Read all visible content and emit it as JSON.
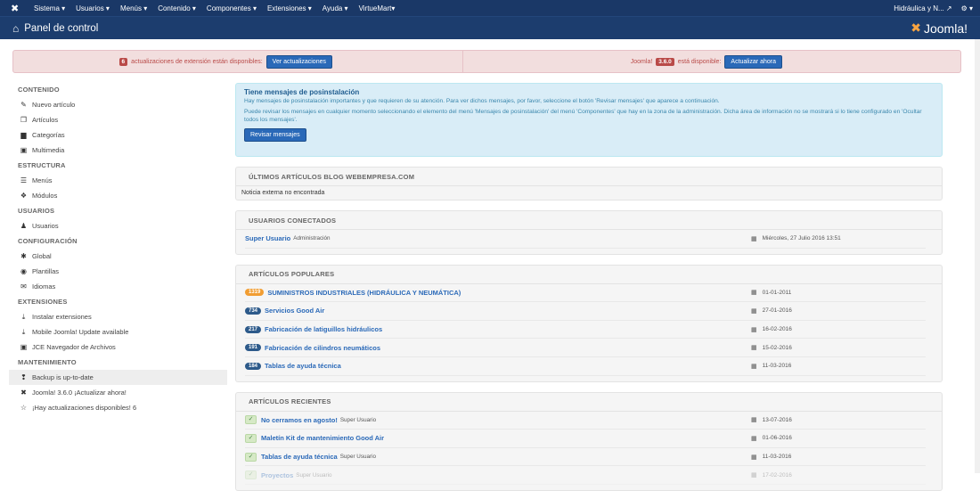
{
  "topbar": {
    "menu": [
      "Sistema ▾",
      "Usuarios ▾",
      "Menús ▾",
      "Contenido ▾",
      "Componentes ▾",
      "Extensiones ▾",
      "Ayuda ▾",
      "VirtueMart▾"
    ],
    "site_label": "Hidráulica y N... ↗",
    "settings_label": "⚙ ▾"
  },
  "header": {
    "title": "Panel de control",
    "brand": "Joomla!"
  },
  "alert": {
    "left_count": "6",
    "left_text": "actualizaciones de extensión están disponibles:",
    "left_button": "Ver actualizaciones",
    "right_pre": "Joomla!",
    "right_version": "3.6.0",
    "right_text": "está disponible:",
    "right_button": "Actualizar ahora"
  },
  "sidebar": {
    "sections": [
      {
        "title": "CONTENIDO",
        "items": [
          {
            "icon": "✎",
            "label": "Nuevo artículo"
          },
          {
            "icon": "❐",
            "label": "Artículos"
          },
          {
            "icon": "▆",
            "label": "Categorías"
          },
          {
            "icon": "▣",
            "label": "Multimedia"
          }
        ]
      },
      {
        "title": "ESTRUCTURA",
        "items": [
          {
            "icon": "☰",
            "label": "Menús"
          },
          {
            "icon": "❖",
            "label": "Módulos"
          }
        ]
      },
      {
        "title": "USUARIOS",
        "items": [
          {
            "icon": "♟",
            "label": "Usuarios"
          }
        ]
      },
      {
        "title": "CONFIGURACIÓN",
        "items": [
          {
            "icon": "✱",
            "label": "Global"
          },
          {
            "icon": "◉",
            "label": "Plantillas"
          },
          {
            "icon": "✉",
            "label": "Idiomas"
          }
        ]
      },
      {
        "title": "EXTENSIONES",
        "items": [
          {
            "icon": "⤓",
            "label": "Instalar extensiones"
          },
          {
            "icon": "⤓",
            "label": "Mobile Joomla! Update available"
          },
          {
            "icon": "▣",
            "label": "JCE Navegador de Archivos"
          }
        ]
      },
      {
        "title": "MANTENIMIENTO",
        "items": [
          {
            "icon": "❢",
            "label": "Backup is up-to-date"
          },
          {
            "icon": "✖",
            "label": "Joomla! 3.6.0 ¡Actualizar ahora!"
          },
          {
            "icon": "☆",
            "label": "¡Hay actualizaciones disponibles! 6"
          }
        ]
      }
    ]
  },
  "info": {
    "title": "Tiene mensajes de posinstalación",
    "p1": "Hay mensajes de posinstalación importantes y que requieren de su atención. Para ver dichos mensajes, por favor, seleccione el botón 'Revisar mensajes' que aparece a continuación.",
    "p2": "Puede revisar los mensajes en cualquier momento seleccionando el elemento del menú 'Mensajes de posinstalación' del menú 'Componentes' que hay en la zona de la administración. Dicha área de información no se mostrará si lo tiene configurado en 'Ocultar todos los mensajes'.",
    "button": "Revisar mensajes"
  },
  "blog": {
    "title": "ÚLTIMOS ARTÍCULOS BLOG WEBEMPRESA.COM",
    "body": "Noticia externa no encontrada"
  },
  "logged": {
    "title": "USUARIOS CONECTADOS",
    "user": "Super Usuario",
    "area": "Administración",
    "date": "Miércoles, 27 Julio 2016 13:51"
  },
  "popular": {
    "title": "ARTÍCULOS POPULARES",
    "rows": [
      {
        "hits": "1319",
        "title": "SUMINISTROS INDUSTRIALES (HIDRÁULICA Y NEUMÁTICA)",
        "date": "01-01-2011"
      },
      {
        "hits": "734",
        "title": "Servicios Good Air",
        "date": "27-01-2016"
      },
      {
        "hits": "217",
        "title": "Fabricación de latiguillos hidráulicos",
        "date": "16-02-2016"
      },
      {
        "hits": "191",
        "title": "Fabricación de cilindros neumáticos",
        "date": "15-02-2016"
      },
      {
        "hits": "184",
        "title": "Tablas de ayuda técnica",
        "date": "11-03-2016"
      }
    ]
  },
  "recent": {
    "title": "ARTÍCULOS RECIENTES",
    "rows": [
      {
        "title": "No cerramos en agosto!",
        "author": "Super Usuario",
        "date": "13-07-2016"
      },
      {
        "title": "Maletín Kit de mantenimiento Good Air",
        "author": "",
        "date": "01-06-2016"
      },
      {
        "title": "Tablas de ayuda técnica",
        "author": "Super Usuario",
        "date": "11-03-2016"
      },
      {
        "title": "Proyectos",
        "author": "Super Usuario",
        "date": "17-02-2016"
      }
    ]
  },
  "colors": {
    "navbar": "#1a3867",
    "header": "#1c3d6e",
    "accent": "#2a69b8",
    "badge_orange": "#f19d32"
  }
}
